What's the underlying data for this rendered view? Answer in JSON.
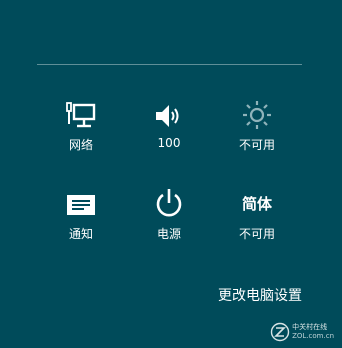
{
  "settings": {
    "network_label": "网络",
    "volume_label": "100",
    "brightness_label": "不可用",
    "notifications_label": "通知",
    "power_label": "电源",
    "keyboard_lang_text": "简体",
    "keyboard_label": "不可用"
  },
  "footer": {
    "pc_settings_label": "更改电脑设置"
  },
  "watermark": {
    "chinese": "中关村在线",
    "domain": "ZOL.com.cn"
  },
  "icons": {
    "network": "network-icon",
    "volume": "speaker-icon",
    "brightness": "sun-icon",
    "notifications": "message-icon",
    "power": "power-icon"
  },
  "colors": {
    "background": "#004b5a",
    "divider": "#5f8f98",
    "foreground": "#ffffff",
    "disabled_icon": "#8fb3ba"
  }
}
